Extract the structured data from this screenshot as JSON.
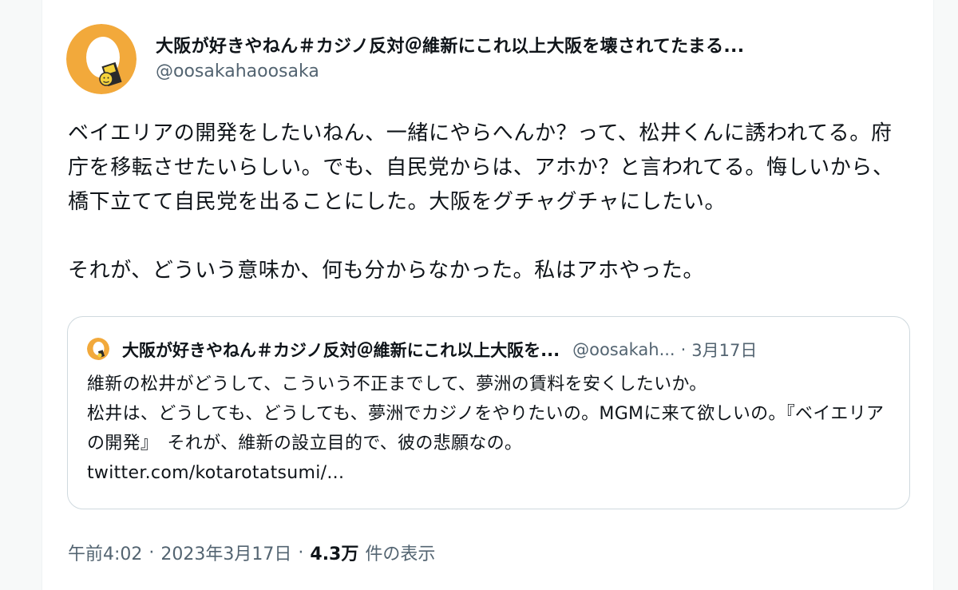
{
  "tweet": {
    "author": {
      "display_name": "大阪が好きやねん＃カジノ反対＠維新にこれ以上大阪を壊されてたまる...",
      "handle": "@oosakahaoosaka",
      "avatar_icon": "egg-character-avatar-icon"
    },
    "text_paragraphs": [
      "ベイエリアの開発をしたいねん、一緒にやらへんか？って、松井くんに誘われてる。府庁を移転させたいらしい。でも、自民党からは、アホか？と言われてる。悔しいから、橋下立てて自民党を出ることにした。大阪をグチャグチャにしたい。",
      "それが、どういう意味か、何も分からなかった。私はアホやった。"
    ],
    "quoted_tweet": {
      "display_name": "大阪が好きやねん＃カジノ反対＠維新にこれ以上大阪を...",
      "handle": "@oosakah...",
      "separator": "·",
      "date": "3月17日",
      "lines": [
        "維新の松井がどうして、こういう不正までして、夢洲の賃料を安くしたいか。",
        "松井は、どうしても、どうしても、夢洲でカジノをやりたいの。MGMに来て欲しいの。『ベイエリアの開発』　それが、維新の設立目的で、彼の悲願なの。",
        "twitter.com/kotarotatsumi/..."
      ]
    },
    "meta": {
      "time": "午前4:02",
      "separator": "·",
      "date": "2023年3月17日",
      "views_count": "4.3万",
      "views_label": "件の表示"
    }
  },
  "colors": {
    "avatar_bg": "#f2a93b",
    "text_primary": "#0f1419",
    "text_secondary": "#536471",
    "border": "#cfd9de"
  }
}
